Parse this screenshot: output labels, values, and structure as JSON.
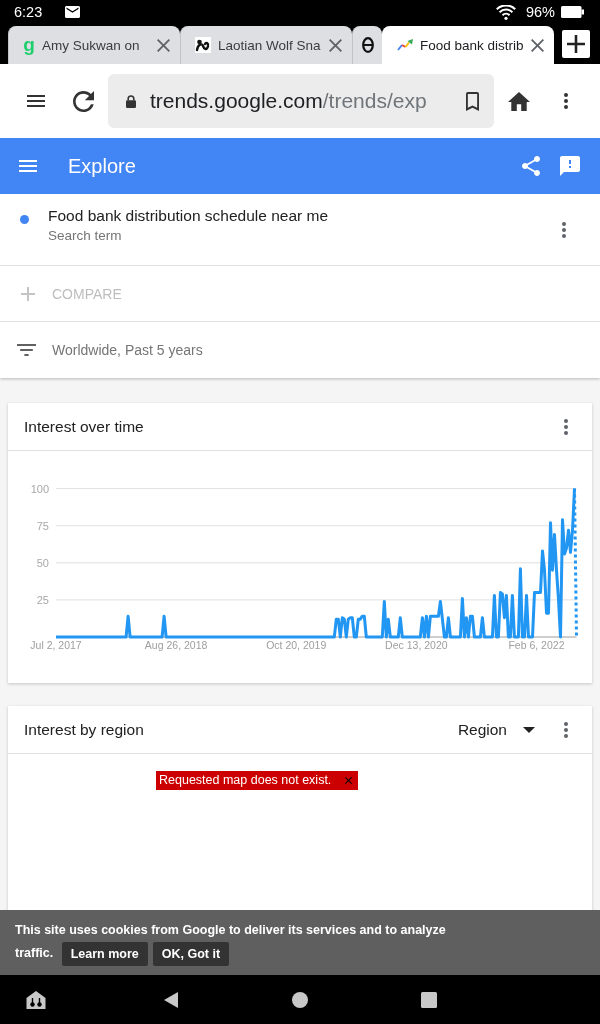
{
  "status_bar": {
    "time": "6:23",
    "battery": "96%"
  },
  "tabs": [
    {
      "title": "Amy Sukwan on",
      "favicon": {
        "kind": "letter",
        "text": "g"
      },
      "selected": false
    },
    {
      "title": "Laotian Wolf Sna",
      "favicon": {
        "kind": "snake"
      },
      "selected": false
    },
    {
      "favicon": {
        "kind": "oval"
      },
      "selected": false
    },
    {
      "title": "Food bank distrib",
      "favicon": {
        "kind": "trends"
      },
      "selected": true
    }
  ],
  "toolbar": {
    "url_host": "trends.google.com",
    "url_path": "/trends/exp"
  },
  "app_bar": {
    "title": "Explore"
  },
  "terms": [
    {
      "label": "Food bank distribution schedule near me",
      "sublabel": "Search term",
      "color": "#4285f4"
    }
  ],
  "compare": {
    "label": "COMPARE",
    "disabled": true
  },
  "filter": {
    "label": "Worldwide, Past 5 years"
  },
  "interest_over_time": {
    "title": "Interest over time",
    "last_point_partial": true,
    "chart_data": {
      "type": "line",
      "grid": true,
      "categories": [
        "Jul 2, 2017",
        null,
        null,
        null,
        null,
        null,
        null,
        null,
        null,
        null,
        null,
        null,
        null,
        null,
        null,
        null,
        null,
        null,
        null,
        null,
        null,
        null,
        null,
        null,
        null,
        null,
        null,
        null,
        null,
        null,
        null,
        null,
        null,
        null,
        null,
        null,
        null,
        null,
        null,
        null,
        null,
        null,
        null,
        null,
        null,
        null,
        null,
        null,
        null,
        null,
        null,
        null,
        null,
        null,
        null,
        null,
        null,
        null,
        null,
        null,
        "Aug 26, 2018",
        null,
        null,
        null,
        null,
        null,
        null,
        null,
        null,
        null,
        null,
        null,
        null,
        null,
        null,
        null,
        null,
        null,
        null,
        null,
        null,
        null,
        null,
        null,
        null,
        null,
        null,
        null,
        null,
        null,
        null,
        null,
        null,
        null,
        null,
        null,
        null,
        null,
        null,
        null,
        null,
        null,
        null,
        null,
        null,
        null,
        null,
        null,
        null,
        null,
        null,
        null,
        null,
        null,
        null,
        null,
        null,
        null,
        null,
        null,
        "Oct 20, 2019",
        null,
        null,
        null,
        null,
        null,
        null,
        null,
        null,
        null,
        null,
        null,
        null,
        null,
        null,
        null,
        null,
        null,
        null,
        null,
        null,
        null,
        null,
        null,
        null,
        null,
        null,
        null,
        null,
        null,
        null,
        null,
        null,
        null,
        null,
        null,
        null,
        null,
        null,
        null,
        null,
        null,
        null,
        null,
        null,
        null,
        null,
        null,
        null,
        null,
        null,
        null,
        null,
        null,
        null,
        null,
        null,
        null,
        null,
        null,
        "Dec 13, 2020",
        null,
        null,
        null,
        null,
        null,
        null,
        null,
        null,
        null,
        null,
        null,
        null,
        null,
        null,
        null,
        null,
        null,
        null,
        null,
        null,
        null,
        null,
        null,
        null,
        null,
        null,
        null,
        null,
        null,
        null,
        null,
        null,
        null,
        null,
        null,
        null,
        null,
        null,
        null,
        null,
        null,
        null,
        null,
        null,
        null,
        null,
        null,
        null,
        null,
        null,
        null,
        null,
        null,
        null,
        null,
        null,
        null,
        null,
        null,
        "Feb 6, 2022",
        null,
        null,
        null,
        null,
        null,
        null,
        null,
        null,
        null,
        null,
        null,
        null,
        null,
        null,
        null,
        null,
        null,
        null,
        null,
        null
      ],
      "ylim": [
        0,
        100
      ],
      "yticks": [
        25,
        50,
        75,
        100
      ],
      "series": [
        {
          "color": "#2196f3",
          "values": [
            0,
            0,
            0,
            0,
            0,
            0,
            0,
            0,
            0,
            0,
            0,
            0,
            0,
            0,
            0,
            0,
            0,
            0,
            0,
            0,
            0,
            0,
            0,
            0,
            0,
            0,
            0,
            0,
            0,
            0,
            0,
            0,
            0,
            0,
            0,
            0,
            14,
            0,
            0,
            0,
            0,
            0,
            0,
            0,
            0,
            0,
            0,
            0,
            0,
            0,
            0,
            0,
            0,
            0,
            14,
            0,
            0,
            0,
            0,
            0,
            0,
            0,
            0,
            0,
            0,
            0,
            0,
            0,
            0,
            0,
            0,
            0,
            0,
            0,
            0,
            0,
            0,
            0,
            0,
            0,
            0,
            0,
            0,
            0,
            0,
            0,
            0,
            0,
            0,
            0,
            0,
            0,
            0,
            0,
            0,
            0,
            0,
            0,
            0,
            0,
            0,
            0,
            0,
            0,
            0,
            0,
            0,
            0,
            0,
            0,
            0,
            0,
            0,
            0,
            0,
            0,
            0,
            0,
            0,
            0,
            0,
            0,
            0,
            0,
            0,
            0,
            0,
            0,
            0,
            0,
            0,
            0,
            0,
            0,
            0,
            0,
            0,
            0,
            0,
            0,
            12,
            12,
            0,
            13,
            12,
            0,
            12,
            13,
            13,
            0,
            0,
            12,
            12,
            14,
            14,
            0,
            0,
            0,
            0,
            0,
            0,
            0,
            0,
            0,
            24,
            0,
            12,
            0,
            0,
            0,
            0,
            0,
            13,
            0,
            0,
            0,
            0,
            0,
            0,
            0,
            0,
            0,
            0,
            13,
            0,
            14,
            0,
            14,
            14,
            14,
            14,
            14,
            24,
            12,
            0,
            0,
            13,
            0,
            0,
            0,
            0,
            0,
            0,
            26,
            0,
            13,
            0,
            14,
            14,
            0,
            0,
            0,
            0,
            13,
            0,
            0,
            0,
            0,
            0,
            28,
            0,
            0,
            30,
            29,
            13,
            28,
            0,
            0,
            28,
            0,
            0,
            0,
            46,
            0,
            0,
            28,
            0,
            0,
            0,
            30,
            30,
            30,
            30,
            58,
            45,
            16,
            16,
            77,
            45,
            69,
            45,
            25,
            0,
            79,
            56,
            60,
            72,
            57,
            72,
            100,
            0
          ]
        }
      ]
    }
  },
  "interest_by_region": {
    "title": "Interest by region",
    "dropdown": "Region",
    "error": "Requested map does not exist."
  },
  "cookie_banner": {
    "text": "This site uses cookies from Google to deliver its services and to analyze traffic.",
    "buttons": [
      "Learn more",
      "OK, Got it"
    ]
  }
}
